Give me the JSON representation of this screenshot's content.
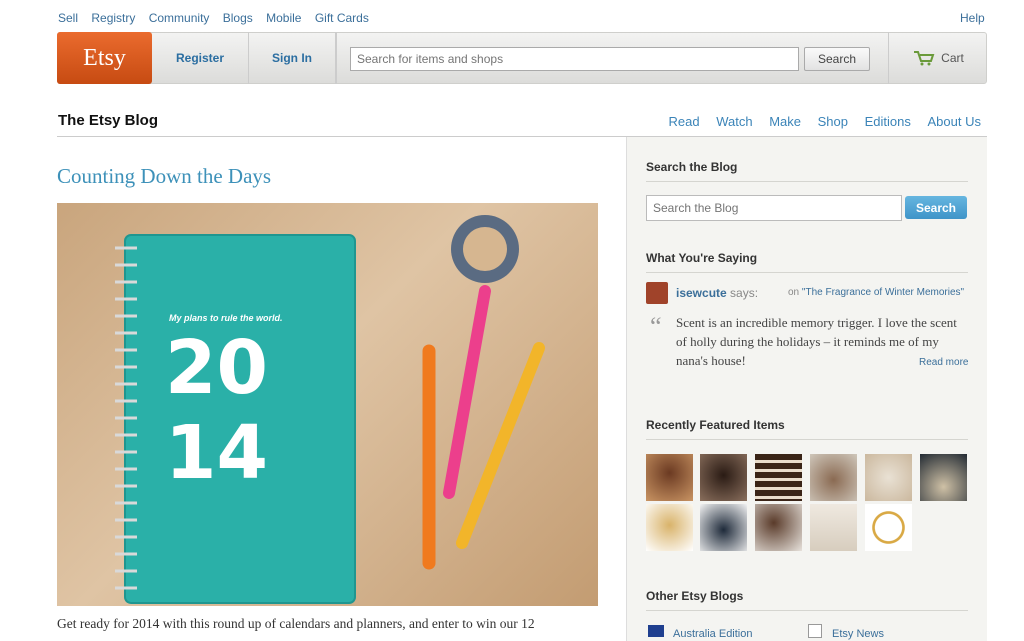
{
  "topnav": {
    "items": [
      "Sell",
      "Registry",
      "Community",
      "Blogs",
      "Mobile",
      "Gift Cards"
    ],
    "help": "Help"
  },
  "header": {
    "logo": "Etsy",
    "register": "Register",
    "signin": "Sign In",
    "search_placeholder": "Search for items and shops",
    "search_button": "Search",
    "cart": "Cart"
  },
  "blog": {
    "title": "The Etsy Blog",
    "nav": [
      "Read",
      "Watch",
      "Make",
      "Shop",
      "Editions",
      "About Us"
    ]
  },
  "post": {
    "title": "Counting Down the Days",
    "excerpt": "Get ready for 2014 with this round up of calendars and planners, and enter to win our 12",
    "photo": {
      "notebook_tagline": "My plans to rule the world.",
      "year_top": "20",
      "year_bottom": "14"
    }
  },
  "sidebar": {
    "search": {
      "heading": "Search the Blog",
      "placeholder": "Search the Blog",
      "button": "Search"
    },
    "comments": {
      "heading": "What You're Saying",
      "user": "isewcute",
      "says": "says:",
      "on": "on",
      "post_link": "\"The Fragrance of Winter Memories\"",
      "quote": "Scent is an incredible memory trigger. I love the scent of holly during the holidays – it reminds me of my nana's house!",
      "read_more": "Read more"
    },
    "featured": {
      "heading": "Recently Featured Items"
    },
    "other": {
      "heading": "Other Etsy Blogs",
      "items": [
        "Australia Edition",
        "Etsy News"
      ]
    }
  },
  "colors": {
    "accent": "#3d91b9",
    "brand": "#d65a1c",
    "link": "#3b6f9a",
    "sidebar_bg": "#f4f4f1"
  }
}
